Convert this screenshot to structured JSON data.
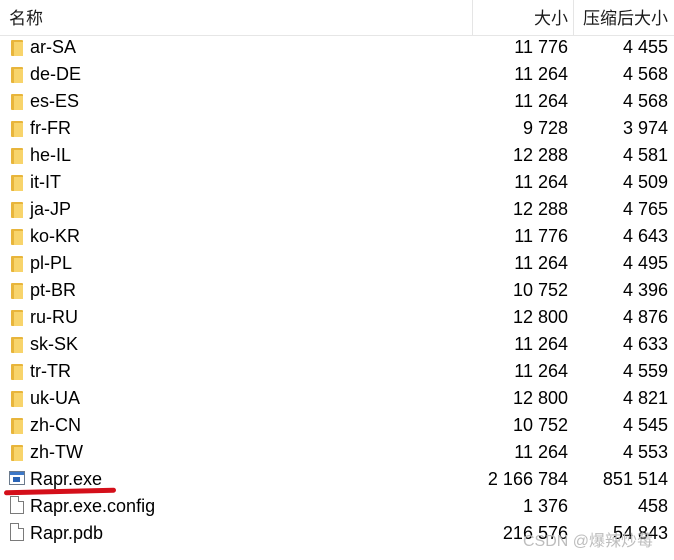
{
  "columns": {
    "name": "名称",
    "size": "大小",
    "packed": "压缩后大小"
  },
  "rows": [
    {
      "name": "ar-SA",
      "size": "11 776",
      "packed": "4 455",
      "icon": "folder-icon"
    },
    {
      "name": "de-DE",
      "size": "11 264",
      "packed": "4 568",
      "icon": "folder-icon"
    },
    {
      "name": "es-ES",
      "size": "11 264",
      "packed": "4 568",
      "icon": "folder-icon"
    },
    {
      "name": "fr-FR",
      "size": "9 728",
      "packed": "3 974",
      "icon": "folder-icon"
    },
    {
      "name": "he-IL",
      "size": "12 288",
      "packed": "4 581",
      "icon": "folder-icon"
    },
    {
      "name": "it-IT",
      "size": "11 264",
      "packed": "4 509",
      "icon": "folder-icon"
    },
    {
      "name": "ja-JP",
      "size": "12 288",
      "packed": "4 765",
      "icon": "folder-icon"
    },
    {
      "name": "ko-KR",
      "size": "11 776",
      "packed": "4 643",
      "icon": "folder-icon"
    },
    {
      "name": "pl-PL",
      "size": "11 264",
      "packed": "4 495",
      "icon": "folder-icon"
    },
    {
      "name": "pt-BR",
      "size": "10 752",
      "packed": "4 396",
      "icon": "folder-icon"
    },
    {
      "name": "ru-RU",
      "size": "12 800",
      "packed": "4 876",
      "icon": "folder-icon"
    },
    {
      "name": "sk-SK",
      "size": "11 264",
      "packed": "4 633",
      "icon": "folder-icon"
    },
    {
      "name": "tr-TR",
      "size": "11 264",
      "packed": "4 559",
      "icon": "folder-icon"
    },
    {
      "name": "uk-UA",
      "size": "12 800",
      "packed": "4 821",
      "icon": "folder-icon"
    },
    {
      "name": "zh-CN",
      "size": "10 752",
      "packed": "4 545",
      "icon": "folder-icon"
    },
    {
      "name": "zh-TW",
      "size": "11 264",
      "packed": "4 553",
      "icon": "folder-icon"
    },
    {
      "name": "Rapr.exe",
      "size": "2 166 784",
      "packed": "851 514",
      "icon": "exe-icon"
    },
    {
      "name": "Rapr.exe.config",
      "size": "1 376",
      "packed": "458",
      "icon": "file-icon"
    },
    {
      "name": "Rapr.pdb",
      "size": "216 576",
      "packed": "54 843",
      "icon": "file-icon"
    }
  ],
  "annotation": {
    "color": "#d40f1a"
  },
  "watermark": "CSDN @爆辣炒莓"
}
